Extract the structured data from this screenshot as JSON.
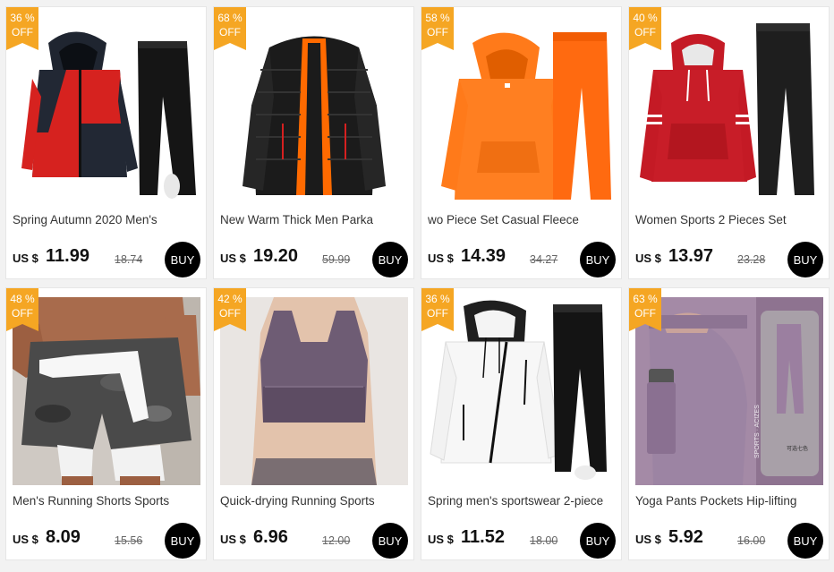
{
  "currency_label": "US $",
  "buy_label": "BUY",
  "discount_suffix": "OFF",
  "badge_color": "#f5a623",
  "products": [
    {
      "discount": "36 %",
      "title": "Spring Autumn 2020 Men's",
      "price": "11.99",
      "original_price": "18.74"
    },
    {
      "discount": "68 %",
      "title": "New Warm Thick Men Parka",
      "price": "19.20",
      "original_price": "59.99"
    },
    {
      "discount": "58 %",
      "title": "wo Piece Set Casual Fleece",
      "price": "14.39",
      "original_price": "34.27"
    },
    {
      "discount": "40 %",
      "title": "Women Sports 2 Pieces Set",
      "price": "13.97",
      "original_price": "23.28"
    },
    {
      "discount": "48 %",
      "title": "Men's Running Shorts Sports",
      "price": "8.09",
      "original_price": "15.56"
    },
    {
      "discount": "42 %",
      "title": "Quick-drying Running Sports",
      "price": "6.96",
      "original_price": "12.00"
    },
    {
      "discount": "36 %",
      "title": "Spring men's sportswear 2-piece",
      "price": "11.52",
      "original_price": "18.00"
    },
    {
      "discount": "63 %",
      "title": "Yoga Pants Pockets Hip-lifting",
      "price": "5.92",
      "original_price": "16.00"
    }
  ],
  "image_labels": {
    "p8_vertical": "SPORTS · ACIZES",
    "p8_small": "可选七色"
  }
}
